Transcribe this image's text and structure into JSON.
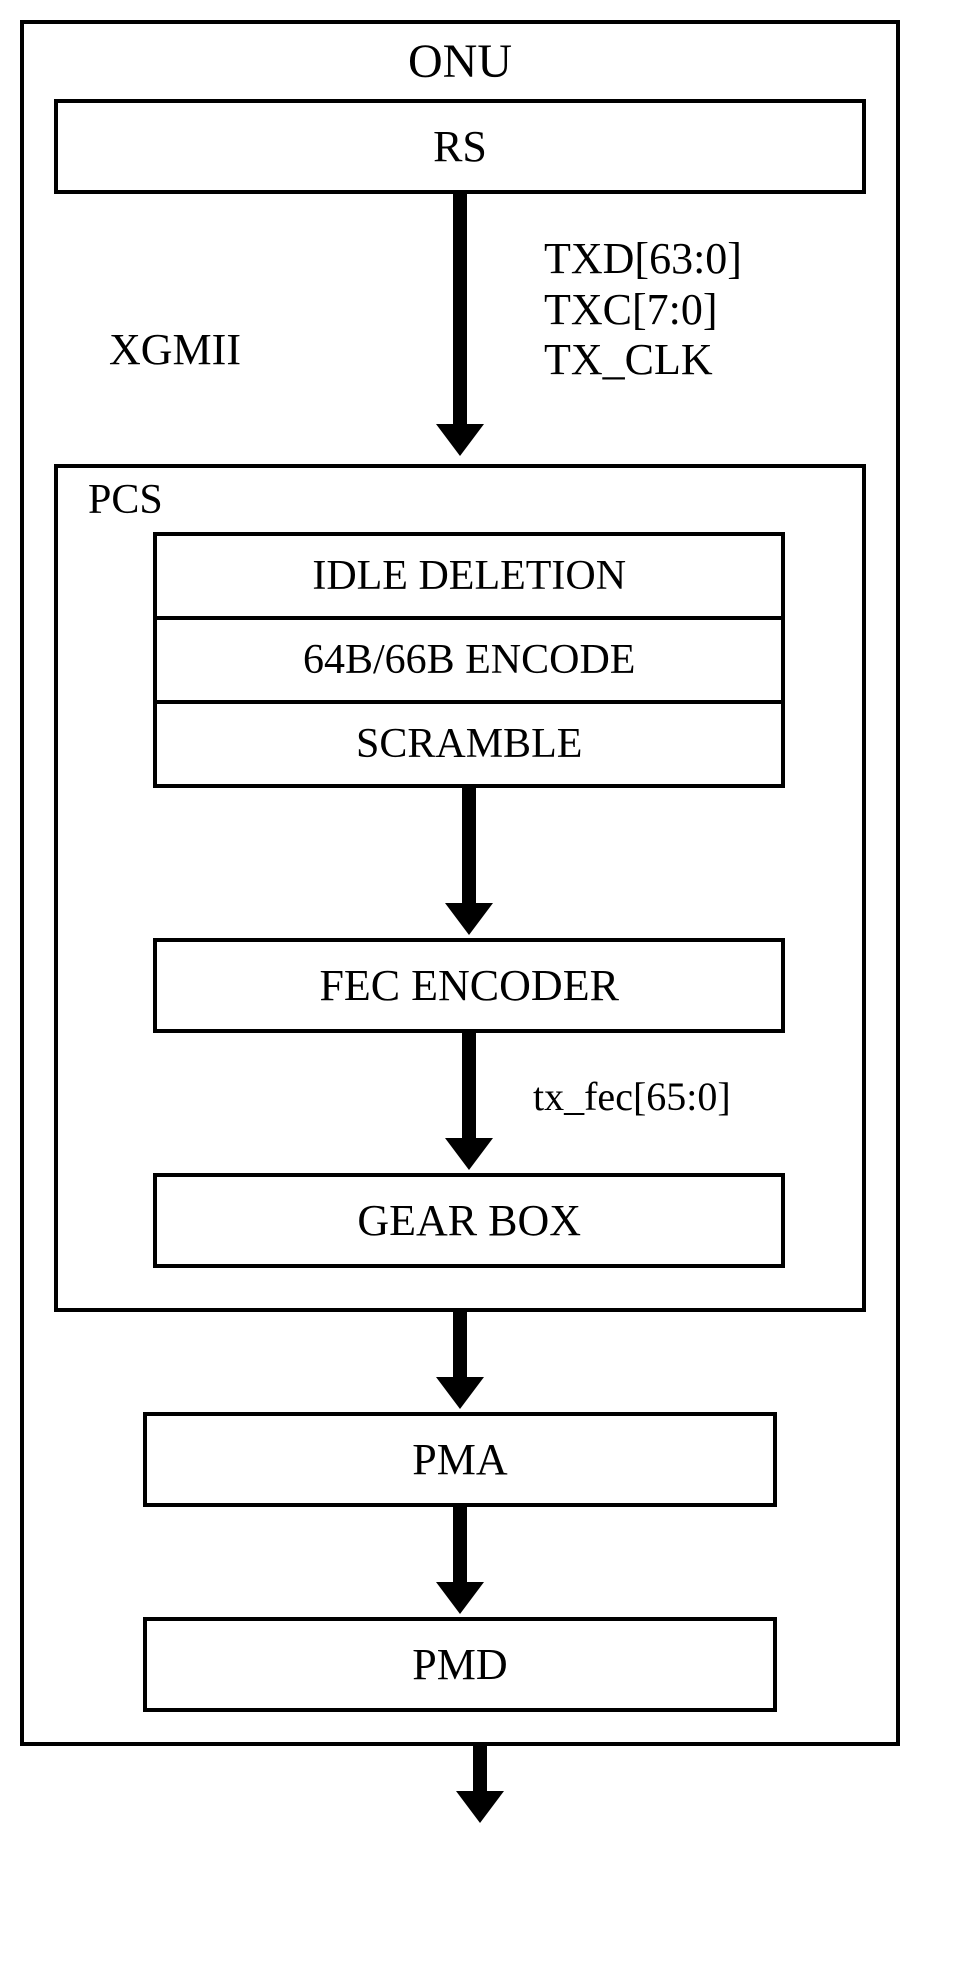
{
  "title": "ONU",
  "rs": "RS",
  "xgmii_label": "XGMII",
  "xgmii_signals": {
    "txd": "TXD[63:0]",
    "txc": "TXC[7:0]",
    "txclk": "TX_CLK"
  },
  "pcs": {
    "label": "PCS",
    "idle_deletion": "IDLE DELETION",
    "encode": "64B/66B ENCODE",
    "scramble": "SCRAMBLE",
    "fec_encoder": "FEC ENCODER",
    "tx_fec_label": "tx_fec[65:0]",
    "gear_box": "GEAR BOX"
  },
  "pma": "PMA",
  "pmd": "PMD"
}
